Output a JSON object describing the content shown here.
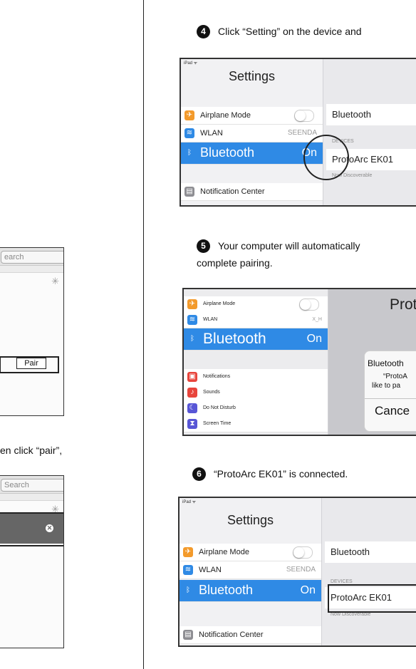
{
  "left_col": {
    "search_placeholder_1": "earch",
    "pair_button": "Pair",
    "instruction_fragment": "en click “pair”,",
    "search_placeholder_2": "Search"
  },
  "steps": [
    {
      "number": "4",
      "text": "Click “Setting” on the device and"
    },
    {
      "number": "5",
      "text": "Your computer will automatically",
      "text2": "complete pairing."
    },
    {
      "number": "6",
      "text": "“ProtoArc EK01” is connected."
    }
  ],
  "settings_screen": {
    "status": "iPad ᯤ",
    "title": "Settings",
    "rows": {
      "airplane": "Airplane Mode",
      "wlan": "WLAN",
      "wlan_value": "SEENDA",
      "bluetooth": "Bluetooth",
      "bluetooth_value": "On",
      "notification": "Notification Center"
    },
    "right": {
      "bluetooth": "Bluetooth",
      "devices": "DEVICES",
      "device": "ProtoArc EK01",
      "discoverable": "Now Discoverable"
    }
  },
  "pairing_screen": {
    "rows": {
      "airplane": "Airplane Mode",
      "wlan": "WLAN",
      "wlan_value": "X_H",
      "bluetooth": "Bluetooth",
      "bluetooth_value": "On",
      "notifications": "Notifications",
      "sounds": "Sounds",
      "dnd": "Do Not Disturb",
      "screen_time": "Screen Time"
    },
    "right_title": "Prot",
    "dialog_title": "Bluetooth",
    "dialog_line1": "“ProtoA",
    "dialog_line2": "like to pa",
    "dialog_button": "Cance"
  },
  "colors": {
    "accent_blue": "#2f8ae5",
    "airplane_orange": "#f39a2b",
    "wlan_blue": "#2f8ae5",
    "notif_gray": "#8e8e93"
  }
}
